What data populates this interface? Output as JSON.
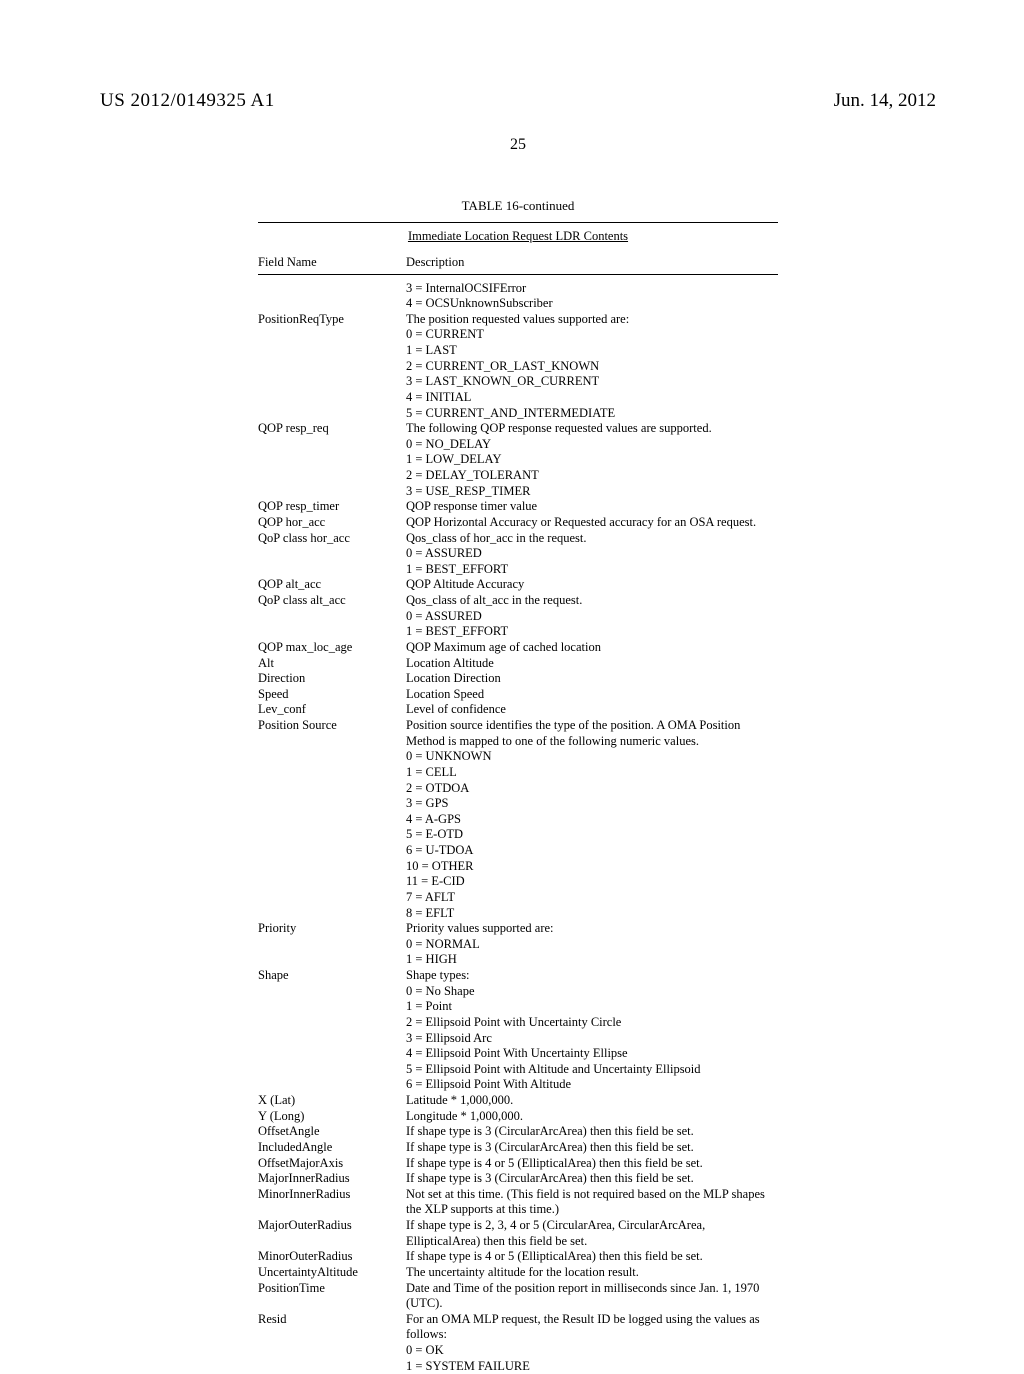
{
  "header": {
    "pubnum": "US 2012/0149325 A1",
    "pubdate": "Jun. 14, 2012"
  },
  "pagenum": "25",
  "table": {
    "title": "TABLE 16-continued",
    "subtitle": "Immediate Location Request LDR Contents",
    "head": {
      "field": "Field Name",
      "desc": "Description"
    },
    "rows": [
      {
        "field": "",
        "desc": [
          "3 = InternalOCSIFError",
          "4 = OCSUnknownSubscriber"
        ]
      },
      {
        "field": "PositionReqType",
        "desc": [
          "The position requested values supported are:",
          "0 = CURRENT",
          "1 = LAST",
          "2 = CURRENT_OR_LAST_KNOWN",
          "3 = LAST_KNOWN_OR_CURRENT",
          "4 = INITIAL",
          "5 = CURRENT_AND_INTERMEDIATE"
        ]
      },
      {
        "field": "QOP resp_req",
        "desc": [
          "The following QOP response requested values are supported.",
          "0 = NO_DELAY",
          "1 = LOW_DELAY",
          "2 = DELAY_TOLERANT",
          "3 = USE_RESP_TIMER"
        ]
      },
      {
        "field": "QOP resp_timer",
        "desc": [
          "QOP response timer value"
        ]
      },
      {
        "field": "QOP hor_acc",
        "desc": [
          "QOP Horizontal Accuracy or Requested accuracy for an OSA request."
        ]
      },
      {
        "field": "QoP class hor_acc",
        "desc": [
          "Qos_class of hor_acc in the request.",
          "0 = ASSURED",
          "1 = BEST_EFFORT"
        ]
      },
      {
        "field": "QOP alt_acc",
        "desc": [
          "QOP Altitude Accuracy"
        ]
      },
      {
        "field": "QoP class alt_acc",
        "desc": [
          "Qos_class of alt_acc in the request.",
          "0 = ASSURED",
          "1 = BEST_EFFORT"
        ]
      },
      {
        "field": "QOP max_loc_age",
        "desc": [
          "QOP Maximum age of cached location"
        ]
      },
      {
        "field": "Alt",
        "desc": [
          "Location Altitude"
        ]
      },
      {
        "field": "Direction",
        "desc": [
          "Location Direction"
        ]
      },
      {
        "field": "Speed",
        "desc": [
          "Location Speed"
        ]
      },
      {
        "field": "Lev_conf",
        "desc": [
          "Level of confidence"
        ]
      },
      {
        "field": "Position Source",
        "desc": [
          "Position source identifies the type of the position. A OMA Position Method is mapped to one of the following numeric values.",
          "0 = UNKNOWN",
          "1 = CELL",
          "2 = OTDOA",
          "3 = GPS",
          "4 = A-GPS",
          "5 = E-OTD",
          "6 = U-TDOA",
          "10 = OTHER",
          "11 = E-CID",
          "7 = AFLT",
          "8 = EFLT"
        ]
      },
      {
        "field": "Priority",
        "desc": [
          "Priority values supported are:",
          "0 = NORMAL",
          "1 = HIGH"
        ]
      },
      {
        "field": "Shape",
        "desc": [
          "Shape types:",
          "0 = No Shape",
          "1 = Point",
          "2 = Ellipsoid Point with Uncertainty Circle",
          "3 = Ellipsoid Arc",
          "4 = Ellipsoid Point With Uncertainty Ellipse",
          "5 = Ellipsoid Point with Altitude and Uncertainty Ellipsoid",
          "6 = Ellipsoid Point With Altitude"
        ]
      },
      {
        "field": "X (Lat)",
        "desc": [
          "Latitude * 1,000,000."
        ]
      },
      {
        "field": "Y (Long)",
        "desc": [
          "Longitude * 1,000,000."
        ]
      },
      {
        "field": "OffsetAngle",
        "desc": [
          "If shape type is 3 (CircularArcArea) then this field be set."
        ]
      },
      {
        "field": "IncludedAngle",
        "desc": [
          "If shape type is 3 (CircularArcArea) then this field be set."
        ]
      },
      {
        "field": "OffsetMajorAxis",
        "desc": [
          "If shape type is 4 or 5 (EllipticalArea) then this field be set."
        ]
      },
      {
        "field": "MajorInnerRadius",
        "desc": [
          "If shape type is 3 (CircularArcArea) then this field be set."
        ]
      },
      {
        "field": "MinorInnerRadius",
        "desc": [
          "Not set at this time. (This field is not required based on the MLP shapes the XLP supports at this time.)"
        ]
      },
      {
        "field": "MajorOuterRadius",
        "desc": [
          "If shape type is 2, 3, 4 or 5 (CircularArea, CircularArcArea, EllipticalArea) then this field be set."
        ]
      },
      {
        "field": "MinorOuterRadius",
        "desc": [
          "If shape type is 4 or 5 (EllipticalArea) then this field be set."
        ]
      },
      {
        "field": "UncertaintyAltitude",
        "desc": [
          "The uncertainty altitude for the location result."
        ]
      },
      {
        "field": "PositionTime",
        "desc": [
          "Date and Time of the position report in milliseconds since Jan. 1, 1970 (UTC)."
        ]
      },
      {
        "field": "Resid",
        "desc": [
          "For an OMA MLP request, the Result ID be logged using the values as follows:",
          "0 = OK",
          "1 = SYSTEM FAILURE"
        ]
      }
    ]
  }
}
